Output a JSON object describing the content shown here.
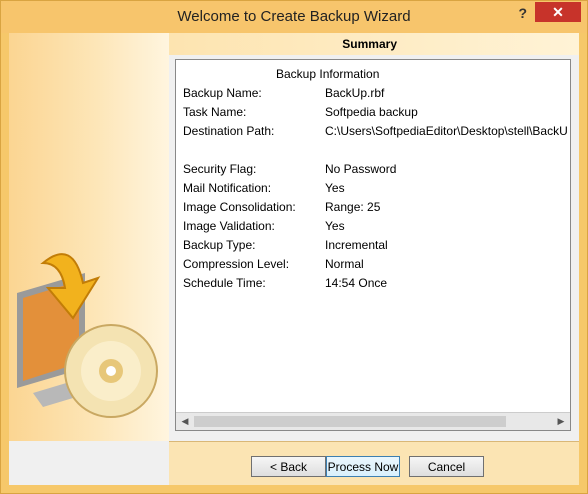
{
  "window": {
    "title": "Welcome to Create Backup Wizard",
    "help": "?",
    "close": "✕"
  },
  "header": {
    "summary": "Summary"
  },
  "info": {
    "section": "Backup Information",
    "rows": [
      {
        "label": "Backup Name:",
        "value": "BackUp.rbf"
      },
      {
        "label": "Task Name:",
        "value": "Softpedia backup"
      },
      {
        "label": "Destination Path:",
        "value": "C:\\Users\\SoftpediaEditor\\Desktop\\stell\\BackU"
      },
      {
        "label": "Security Flag:",
        "value": "No Password"
      },
      {
        "label": "Mail Notification:",
        "value": "Yes"
      },
      {
        "label": "Image Consolidation:",
        "value": "Range: 25"
      },
      {
        "label": "Image Validation:",
        "value": "Yes"
      },
      {
        "label": "Backup Type:",
        "value": "Incremental"
      },
      {
        "label": "Compression Level:",
        "value": "Normal"
      },
      {
        "label": "Schedule Time:",
        "value": "14:54  Once"
      }
    ]
  },
  "buttons": {
    "back": "< Back",
    "process": "Process Now",
    "cancel": "Cancel"
  },
  "colors": {
    "accent": "#f7c56c",
    "close": "#c7332a"
  }
}
